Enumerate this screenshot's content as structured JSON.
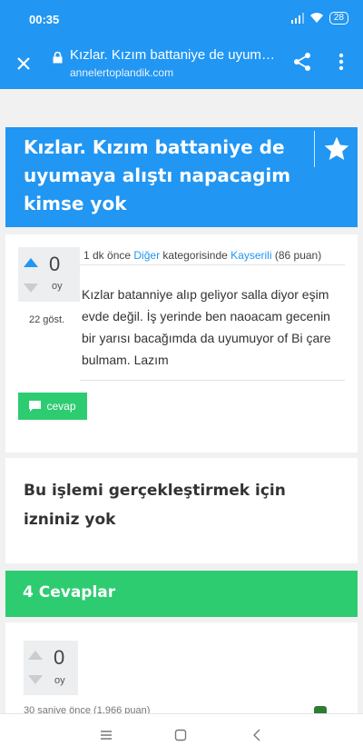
{
  "status_bar": {
    "time": "00:35",
    "battery": "28"
  },
  "browser": {
    "page_title": "Kızlar. Kızım battaniye de uyumaya alıştı napacagim kimse yok",
    "domain": "annelertoplandik.com"
  },
  "question": {
    "title": "Kızlar. Kızım battaniye de uyumaya alıştı napacagim kimse yok",
    "votes": "0",
    "votes_label": "oy",
    "views": "22 göst.",
    "meta_time": "1 dk önce",
    "category": "Diğer",
    "category_suffix": "kategorisinde",
    "user": "Kayserili",
    "points": "(86 puan)",
    "body": "Kızlar batanniye alıp geliyor salla diyor eşim evde değil. İş yerinde ben naoacam gecenin bir yarısı bacağımda da uyumuyor of Bi çare bulmam. Lazım",
    "answer_button": "cevap"
  },
  "permission": {
    "message": "Bu işlemi gerçekleştirmek için izniniz yok"
  },
  "answers": {
    "header": "4 Cevaplar",
    "first": {
      "votes": "0",
      "votes_label": "oy",
      "meta": "30 saniye önce (1.966 puan)"
    }
  },
  "colors": {
    "primary": "#2196f3",
    "success": "#2ecc71"
  },
  "icons": [
    "close-icon",
    "lock-icon",
    "share-icon",
    "more-vert-icon",
    "star-icon",
    "arrow-up-icon",
    "arrow-down-icon",
    "comment-icon",
    "menu-icon",
    "home-icon",
    "back-icon"
  ]
}
